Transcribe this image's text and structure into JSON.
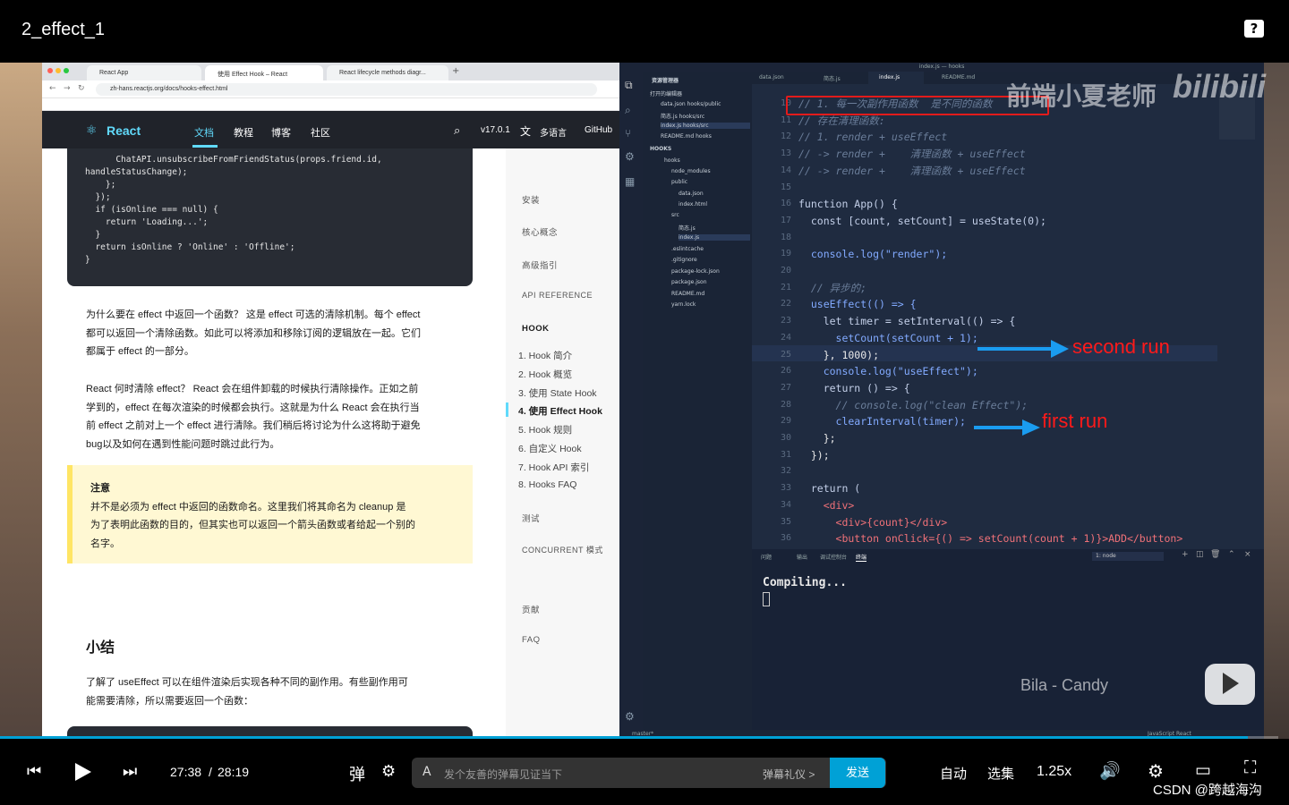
{
  "header": {
    "title": "2_effect_1",
    "help_label": "?"
  },
  "browser": {
    "tabs": [
      "React App",
      "使用 Effect Hook – React",
      "React lifecycle methods diagr..."
    ],
    "url": "zh-hans.reactjs.org/docs/hooks-effect.html",
    "nav": {
      "logo": "React",
      "links": [
        "文档",
        "教程",
        "博客",
        "社区"
      ],
      "version": "v17.0.1",
      "lang": "多语言",
      "github": "GitHub"
    },
    "code_top": [
      "      ChatAPI.unsubscribeFromFriendStatus(props.friend.id,",
      "handleStatusChange);",
      "    };",
      "  });",
      "",
      "  if (isOnline === null) {",
      "    return 'Loading...';",
      "  }",
      "  return isOnline ? 'Online' : 'Offline';",
      "}"
    ],
    "para1": [
      "为什么要在 effect 中返回一个函数？ 这是 effect 可选的清除机制。每个 effect",
      "都可以返回一个清除函数。如此可以将添加和移除订阅的逻辑放在一起。它们",
      "都属于 effect 的一部分。"
    ],
    "para2": [
      "React 何时清除 effect？ React 会在组件卸载的时候执行清除操作。正如之前",
      "学到的，effect 在每次渲染的时候都会执行。这就是为什么 React 会在执行当",
      "前 effect 之前对上一个 effect 进行清除。我们稍后将讨论为什么这将助于避免",
      "bug以及如何在遇到性能问题时跳过此行为。"
    ],
    "note_title": "注意",
    "note_lines": [
      "并不是必须为 effect 中返回的函数命名。这里我们将其命名为 cleanup 是",
      "为了表明此函数的目的，但其实也可以返回一个箭头函数或者给起一个别的",
      "名字。"
    ],
    "summary_title": "小结",
    "summary_lines": [
      "了解了 useEffect 可以在组件渲染后实现各种不同的副作用。有些副作用可",
      "能需要清除，所以需要返回一个函数："
    ],
    "sidebar": {
      "sections": [
        "安装",
        "核心概念",
        "高级指引",
        "API REFERENCE",
        "HOOK",
        "测试",
        "CONCURRENT 模式",
        "贡献",
        "FAQ"
      ],
      "hook_items": [
        "1. Hook 简介",
        "2. Hook 概览",
        "3. 使用 State Hook",
        "4. 使用 Effect Hook",
        "5. Hook 规则",
        "6. 自定义 Hook",
        "7. Hook API 索引",
        "8. Hooks FAQ"
      ]
    }
  },
  "vscode": {
    "window_title": "index.js — hooks",
    "editor_tabs": [
      "data.json",
      "简态.js",
      "index.js",
      "README.md"
    ],
    "explorer": {
      "title": "资源管理器",
      "open_editors": "打开的编辑器",
      "open_files": [
        "data.json  hooks/public",
        "简态.js  hooks/src",
        "index.js  hooks/src",
        "README.md  hooks"
      ],
      "project": "HOOKS",
      "tree": [
        "hooks",
        "node_modules",
        "public",
        "data.json",
        "index.html",
        "src",
        "简态.js",
        "index.js",
        ".eslintcache",
        ".gitignore",
        "package-lock.json",
        "package.json",
        "README.md",
        "yarn.lock"
      ]
    },
    "code_lines": [
      {
        "n": "10",
        "t": "// 1. 每一次副作用函数  是不同的函数"
      },
      {
        "n": "11",
        "t": "// 存在清理函数:"
      },
      {
        "n": "12",
        "t": "// 1. render + useEffect"
      },
      {
        "n": "13",
        "t": "// -> render +    清理函数 + useEffect"
      },
      {
        "n": "14",
        "t": "// -> render +    清理函数 + useEffect"
      },
      {
        "n": "15",
        "t": ""
      },
      {
        "n": "16",
        "t": "function App() {"
      },
      {
        "n": "17",
        "t": "  const [count, setCount] = useState(0);"
      },
      {
        "n": "18",
        "t": ""
      },
      {
        "n": "19",
        "t": "  console.log(\"render\");"
      },
      {
        "n": "20",
        "t": ""
      },
      {
        "n": "21",
        "t": "  // 异步的;"
      },
      {
        "n": "22",
        "t": "  useEffect(() => {"
      },
      {
        "n": "23",
        "t": "    let timer = setInterval(() => {"
      },
      {
        "n": "24",
        "t": "      setCount(setCount + 1);"
      },
      {
        "n": "25",
        "t": "    }, 1000);"
      },
      {
        "n": "26",
        "t": "    console.log(\"useEffect\");"
      },
      {
        "n": "27",
        "t": "    return () => {"
      },
      {
        "n": "28",
        "t": "      // console.log(\"clean Effect\");"
      },
      {
        "n": "29",
        "t": "      clearInterval(timer);"
      },
      {
        "n": "30",
        "t": "    };"
      },
      {
        "n": "31",
        "t": "  });"
      },
      {
        "n": "32",
        "t": ""
      },
      {
        "n": "33",
        "t": "  return ("
      },
      {
        "n": "34",
        "t": "    <div>"
      },
      {
        "n": "35",
        "t": "      <div>{count}</div>"
      },
      {
        "n": "36",
        "t": "      <button onClick={() => setCount(count + 1)}>ADD</button>"
      }
    ],
    "panel_tabs": [
      "问题",
      "输出",
      "调试控制台",
      "终端"
    ],
    "terminal_select": "1: node",
    "terminal_output": "Compiling...",
    "status_left": "master*",
    "status_right": "JavaScript React"
  },
  "overlay": {
    "watermark": "前端小夏老师",
    "bili": "bilibili",
    "second_run": "second run",
    "first_run": "first run",
    "music": "Bila - Candy",
    "arrow_color": "#1a9cf0",
    "annotation_color": "#ff1a1a"
  },
  "player": {
    "current_time": "27:38",
    "separator": "/",
    "duration": "28:19",
    "progress_fraction": 0.976,
    "danmaku_placeholder": "发个友善的弹幕见证当下",
    "etiquette": "弹幕礼仪 >",
    "send": "发送",
    "auto": "自动",
    "episodes": "选集",
    "speed": "1.25x",
    "credit": "CSDN @跨越海沟",
    "accent": "#00a1d6"
  }
}
